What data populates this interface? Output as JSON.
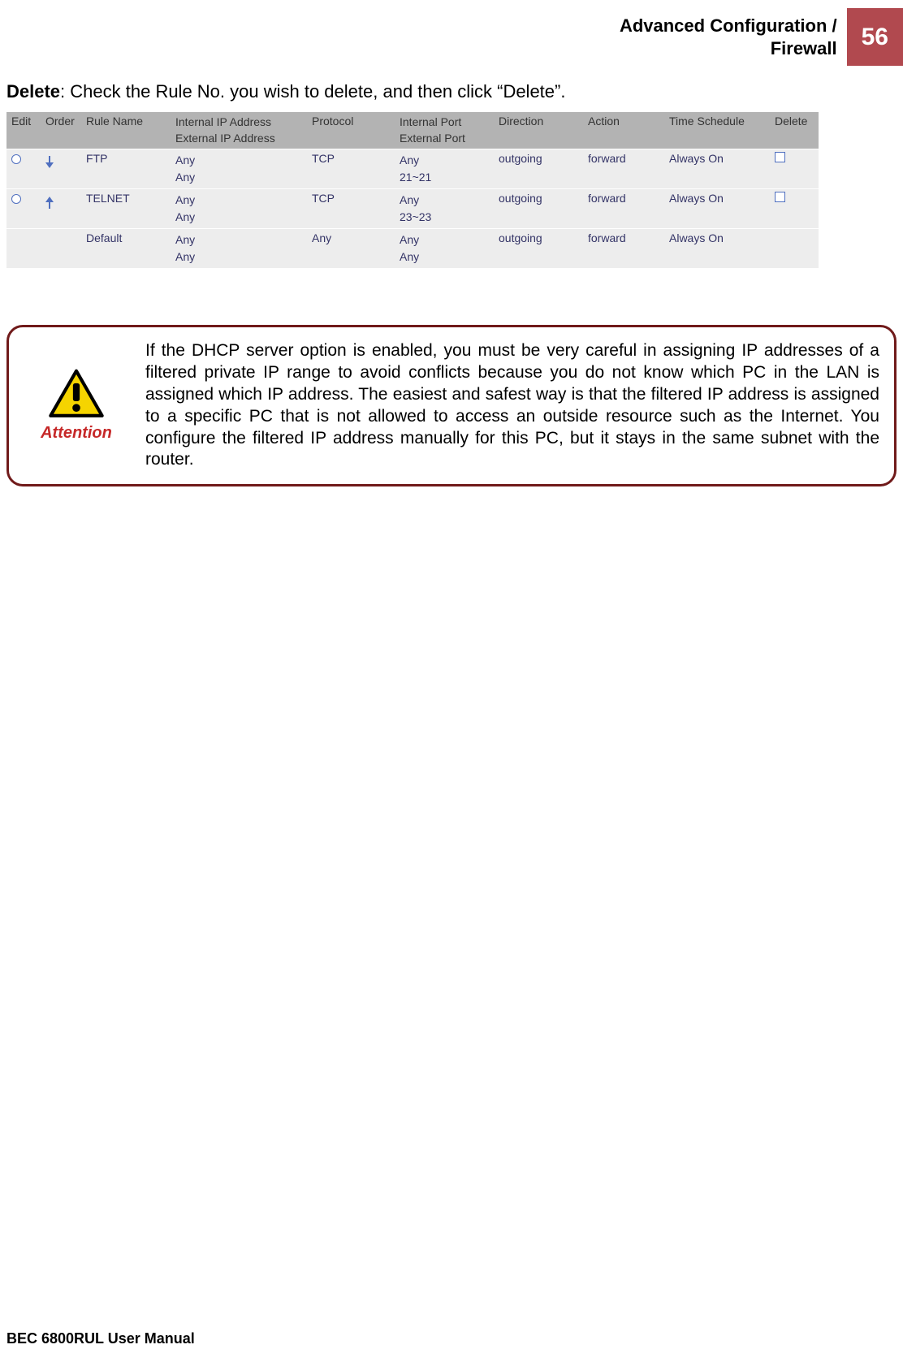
{
  "header": {
    "line1": "Advanced Configuration /",
    "line2": "Firewall",
    "page_number": "56"
  },
  "intro": {
    "bold": "Delete",
    "rest": ": Check the Rule No. you wish to delete, and then click “Delete”."
  },
  "table": {
    "headers": {
      "edit": "Edit",
      "order": "Order",
      "rule_name": "Rule Name",
      "ip_line1": "Internal IP Address",
      "ip_line2": "External IP Address",
      "protocol": "Protocol",
      "port_line1": "Internal Port",
      "port_line2": "External Port",
      "direction": "Direction",
      "action": "Action",
      "schedule": "Time Schedule",
      "delete": "Delete"
    },
    "rows": [
      {
        "has_radio": true,
        "arrow": "down",
        "rule_name": "FTP",
        "ip1": "Any",
        "ip2": "Any",
        "protocol": "TCP",
        "port1": "Any",
        "port2": "21~21",
        "direction": "outgoing",
        "action": "forward",
        "schedule": "Always On",
        "has_checkbox": true
      },
      {
        "has_radio": true,
        "arrow": "up",
        "rule_name": "TELNET",
        "ip1": "Any",
        "ip2": "Any",
        "protocol": "TCP",
        "port1": "Any",
        "port2": "23~23",
        "direction": "outgoing",
        "action": "forward",
        "schedule": "Always On",
        "has_checkbox": true
      },
      {
        "has_radio": false,
        "arrow": "",
        "rule_name": "Default",
        "ip1": "Any",
        "ip2": "Any",
        "protocol": "Any",
        "port1": "Any",
        "port2": "Any",
        "direction": "outgoing",
        "action": "forward",
        "schedule": "Always On",
        "has_checkbox": false
      }
    ]
  },
  "attention": {
    "label": "Attention",
    "text": "If the DHCP server option is enabled, you must be very careful in assigning IP addresses of a filtered private IP range to avoid conflicts because you do not know which PC in the LAN is assigned which IP address. The easiest and safest way is that the filtered IP address is assigned to a specific PC that is not allowed to access an outside resource such as the Internet. You configure the filtered IP address manually for this PC, but it stays in the same subnet with the router."
  },
  "footer": "BEC 6800RUL User Manual"
}
